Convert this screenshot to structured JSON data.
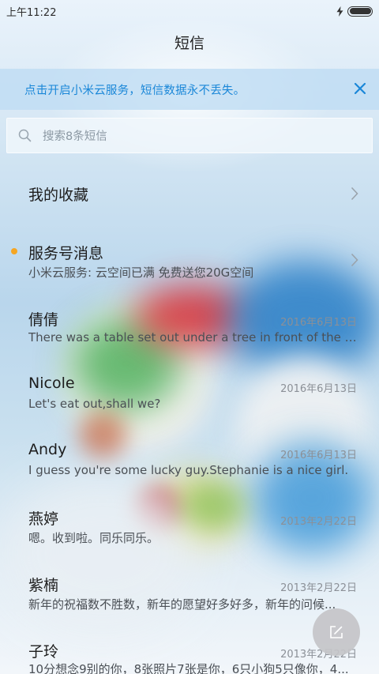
{
  "status_bar": {
    "time": "上午11:22",
    "battery_level": 1.0,
    "charging": true
  },
  "header": {
    "title": "短信"
  },
  "cloud_banner": {
    "text": "点击开启小米云服务，短信数据永不丢失。",
    "close_icon": "close-icon",
    "accent_color": "#1a87d8"
  },
  "search": {
    "placeholder": "搜索8条短信",
    "icon": "search-icon"
  },
  "favorites": {
    "label": "我的收藏",
    "icon": "chevron-right-icon"
  },
  "service_messages": {
    "title": "服务号消息",
    "snippet": "小米云服务: 云空间已满 免费送您20G空间",
    "unread": true,
    "unread_color": "#f5a623"
  },
  "conversations": [
    {
      "name": "倩倩",
      "date": "2016年6月13日",
      "snippet": "There was a table set out under a tree in front of the ho..."
    },
    {
      "name": "Nicole",
      "date": "2016年6月13日",
      "snippet": "Let's eat out,shall we?"
    },
    {
      "name": "Andy",
      "date": "2016年6月13日",
      "snippet": "I guess you're some lucky guy.Stephanie is a nice girl."
    },
    {
      "name": "燕婷",
      "date": "2013年2月22日",
      "snippet": "嗯。收到啦。同乐同乐。"
    },
    {
      "name": "紫楠",
      "date": "2013年2月22日",
      "snippet": "新年的祝福数不胜数，新年的愿望好多好多，新年的问候..."
    },
    {
      "name": "子玲",
      "date": "2013年2月22日",
      "snippet": "10分想念9别的你，8张照片7张是你，6只小狗5只像你，4..."
    }
  ],
  "compose": {
    "icon": "compose-icon"
  }
}
